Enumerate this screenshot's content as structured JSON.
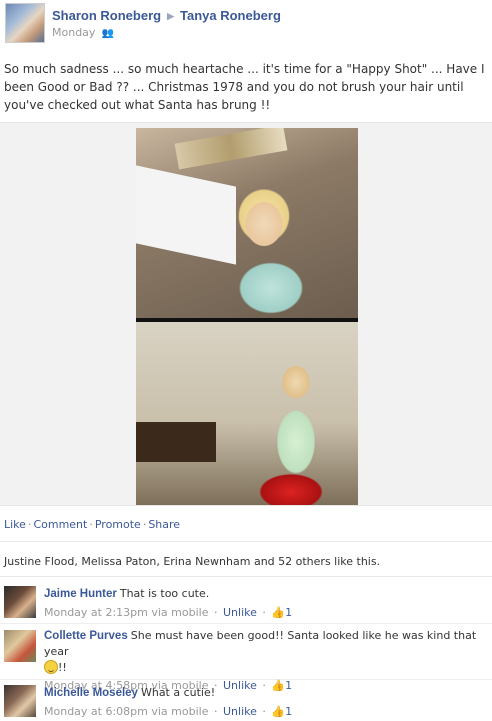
{
  "post": {
    "author": "Sharon Roneberg",
    "target": "Tanya Roneberg",
    "timestamp": "Monday",
    "message": "So much sadness ... so much heartache ... it's time for a \"Happy Shot\" ... Have I been Good or Bad ?? ... Christmas 1978 and you do not brush your hair until you've checked out what Santa has brung !!"
  },
  "actions": {
    "like": "Like",
    "comment": "Comment",
    "promote": "Promote",
    "share": "Share",
    "separator": "·"
  },
  "likes": {
    "text": "Justine Flood, Melissa Paton, Erina Newnham and 52 others like this."
  },
  "comments": [
    {
      "name": "Jaime Hunter",
      "text": "That is too cute.",
      "time": "Monday at 2:13pm via mobile",
      "unlike": "Unlike",
      "likes": "1"
    },
    {
      "name": "Collette Purves",
      "text": "She must have been good!! Santa looked like he was kind that year",
      "text_after": "!!",
      "time": "Monday at 4:58pm via mobile",
      "unlike": "Unlike",
      "likes": "1"
    },
    {
      "name": "Michelle Moseley",
      "text": "What a cutie!",
      "time": "Monday at 6:08pm via mobile",
      "unlike": "Unlike",
      "likes": "1"
    }
  ],
  "icons": {
    "arrow": "right-triangle-icon",
    "friends": "friends-icon",
    "thumb": "thumbs-up-icon",
    "smiley": "smiley-icon"
  },
  "colors": {
    "link": "#3b5998",
    "meta": "#999999"
  }
}
